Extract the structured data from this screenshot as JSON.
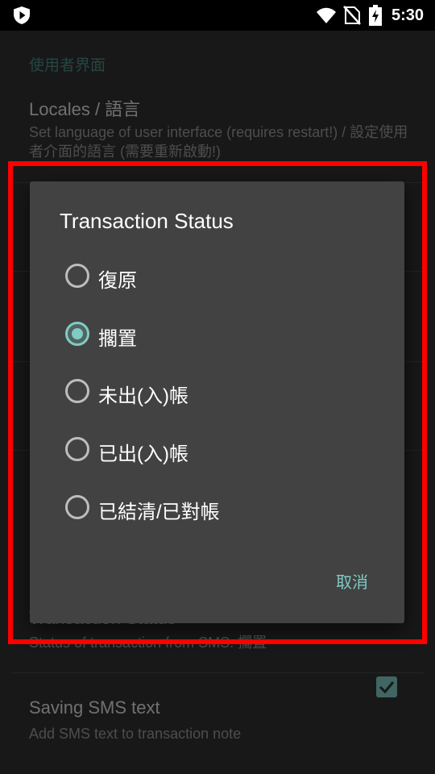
{
  "status_bar": {
    "time": "5:30"
  },
  "settings": {
    "section_header": "使用者界面",
    "locales": {
      "title": "Locales / 語言",
      "summary": "Set language of user interface (requires restart!) / 設定使用者介面的語言 (需要重新啟動!)"
    },
    "transaction_status": {
      "title": "Transaction Status",
      "summary": "Status of transaction from SMS: 擱置"
    },
    "saving_sms": {
      "title": "Saving SMS text",
      "summary": "Add SMS text to transaction note",
      "checked": true
    }
  },
  "dialog": {
    "title": "Transaction Status",
    "options": [
      {
        "label": "復原",
        "checked": false
      },
      {
        "label": "擱置",
        "checked": true
      },
      {
        "label": "未出(入)帳",
        "checked": false
      },
      {
        "label": "已出(入)帳",
        "checked": false
      },
      {
        "label": "已結清/已對帳",
        "checked": false
      }
    ],
    "cancel_label": "取消"
  },
  "colors": {
    "accent": "#80cbc4",
    "highlight": "#ff0000",
    "background": "#303030",
    "dialog": "#424242"
  }
}
